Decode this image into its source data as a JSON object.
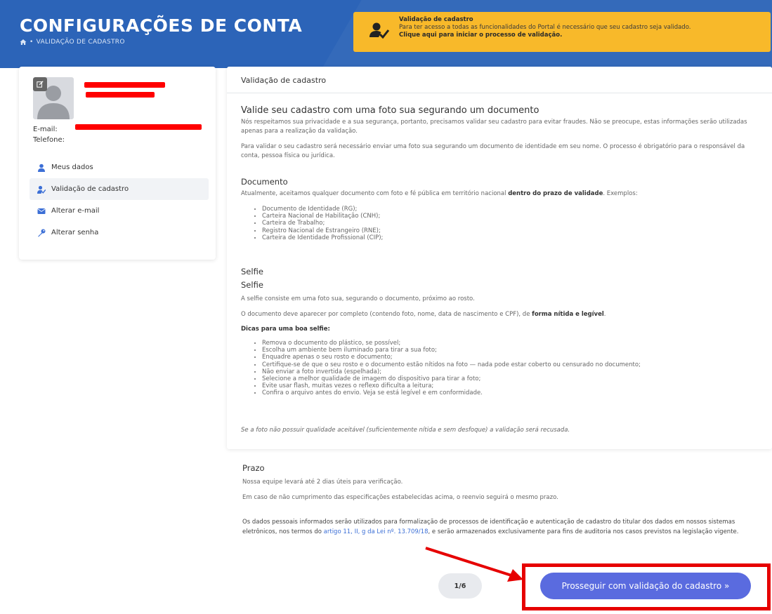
{
  "header": {
    "title": "CONFIGURAÇÕES DE CONTA",
    "breadcrumb_icon": "home-icon",
    "breadcrumb": "VALIDAÇÃO DE CADASTRO"
  },
  "alert": {
    "icon": "user-check-icon",
    "title": "Validação de cadastro",
    "text": "Para ter acesso a todas as funcionalidades do Portal é necessário que seu cadastro seja validado.",
    "link": "Clique aqui para iniciar o processo de validação",
    "link_suffix": "."
  },
  "profile": {
    "email_label": "E-mail:",
    "phone_label": "Telefone:"
  },
  "menu": [
    {
      "label": "Meus dados",
      "icon": "user-icon"
    },
    {
      "label": "Validação de cadastro",
      "icon": "user-check-icon",
      "active": true
    },
    {
      "label": "Alterar e-mail",
      "icon": "envelope-icon"
    },
    {
      "label": "Alterar senha",
      "icon": "key-icon"
    }
  ],
  "main": {
    "card_title": "Validação de cadastro",
    "intro_heading": "Valide seu cadastro com uma foto sua segurando um documento",
    "intro_p1": "Nós respeitamos sua privacidade e a sua segurança, portanto, precisamos validar seu cadastro para evitar fraudes. Não se preocupe, estas informações serão utilizadas apenas para a realização da validação.",
    "intro_p2": "Para validar o seu cadastro será necessário enviar uma foto sua segurando um documento de identidade em seu nome. O processo é obrigatório para o responsável da conta, pessoa física ou jurídica.",
    "doc_heading": "Documento",
    "doc_text_a": "Atualmente, aceitamos qualquer documento com foto e fé pública em território nacional ",
    "doc_text_bold": "dentro do prazo de validade",
    "doc_text_b": ". Exemplos:",
    "doc_list": [
      "Documento de Identidade (RG);",
      "Carteira Nacional de Habilitação (CNH);",
      "Carteira de Trabalho;",
      "Registro Nacional de Estrangeiro (RNE);",
      "Carteira de Identidade Profissional (CIP);"
    ],
    "selfie_heading_1": "Selfie",
    "selfie_heading_2": "Selfie",
    "selfie_p1": "A selfie consiste em uma foto sua, segurando o documento, próximo ao rosto.",
    "selfie_p2_a": "O documento deve aparecer por completo (contendo foto, nome, data de nascimento e CPF), de ",
    "selfie_p2_bold": "forma nítida e legível",
    "selfie_p2_b": ".",
    "tips_title": "Dicas para uma boa selfie:",
    "tips": [
      "Remova o documento do plástico, se possível;",
      "Escolha um ambiente bem iluminado para tirar a sua foto;",
      "Enquadre apenas o seu rosto e documento;",
      "Certifique-se de que o seu rosto e o documento estão nítidos na foto — nada pode estar coberto ou censurado no documento;",
      "Não enviar a foto invertida (espelhada);",
      "Selecione a melhor qualidade de imagem do dispositivo para tirar a foto;",
      "Evite usar flash, muitas vezes o reflexo dificulta a leitura;",
      "Confira o arquivo antes do envio. Veja se está legível e em conformidade."
    ],
    "warning": "Se a foto não possuir qualidade aceitável (suficientemente nítida e sem desfoque) a validação será recusada."
  },
  "prazo": {
    "heading": "Prazo",
    "p1": "Nossa equipe levará até 2 dias úteis para verificação.",
    "p2": "Em caso de não cumprimento das especificações estabelecidas acima, o reenvio seguirá o mesmo prazo.",
    "legal_a": "Os dados pessoais informados serão utilizados para formalização de processos de identificação e autenticação de cadastro do titular dos dados em nossos sistemas eletrônicos, nos termos do ",
    "legal_link": "artigo 11, II, g da Lei nº. 13.709/18",
    "legal_b": ", e serão armazenados exclusivamente para fins de auditoria nos casos previstos na legislação vigente."
  },
  "footer": {
    "page": "1/6",
    "continue_label": "Prosseguir com validação do cadastro »"
  },
  "colors": {
    "header_bg": "#2c64b8",
    "alert_bg": "#f8b92a",
    "primary_button": "#5a6bdf",
    "icon_blue": "#3c6fd6",
    "annotation_red": "#e60000"
  }
}
